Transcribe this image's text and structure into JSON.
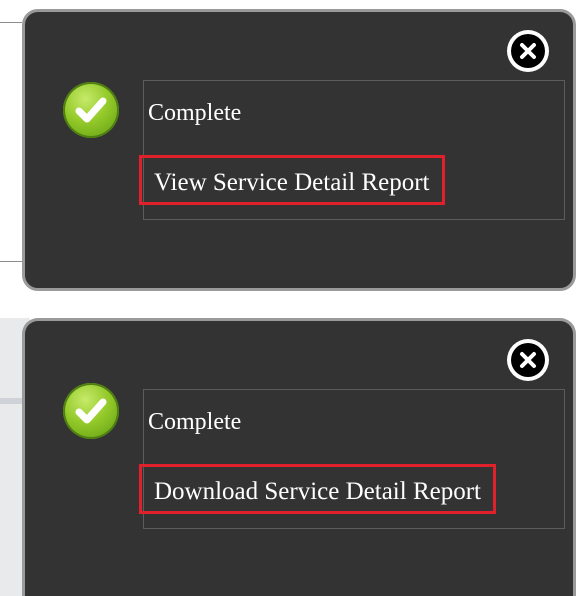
{
  "popups": [
    {
      "status": "Complete",
      "link_label": "View Service Detail Report",
      "close_icon": "close-icon",
      "status_icon": "check-circle-icon"
    },
    {
      "status": "Complete",
      "link_label": "Download Service Detail Report",
      "close_icon": "close-icon",
      "status_icon": "check-circle-icon"
    }
  ],
  "colors": {
    "popup_background": "#333333",
    "popup_border": "#9a9a9a",
    "highlight_border": "#e0202a",
    "success_green": "#93c929"
  }
}
